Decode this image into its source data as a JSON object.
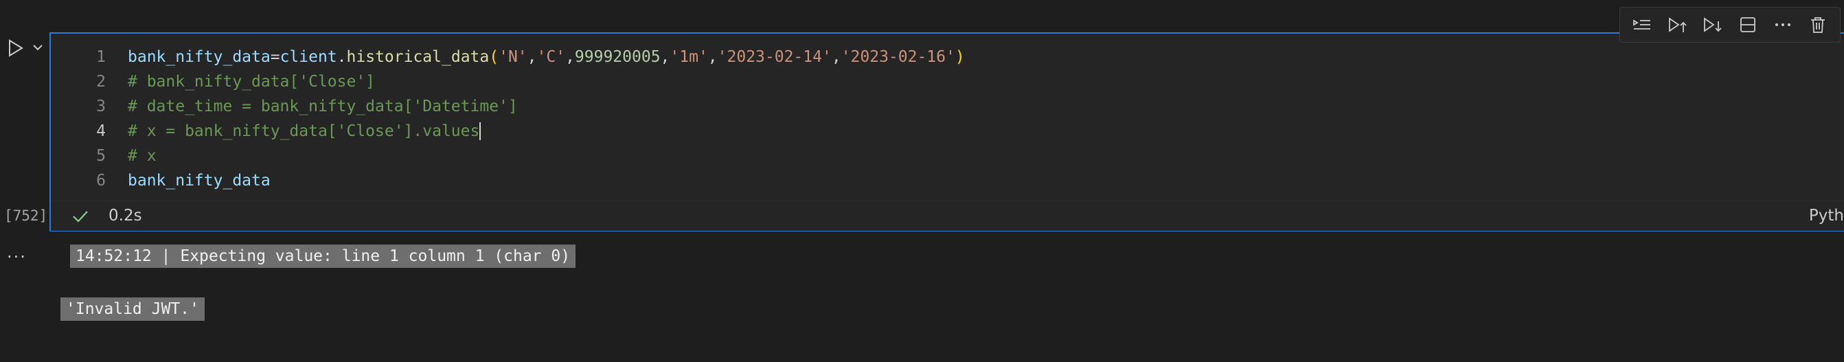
{
  "toolbar": {
    "items": [
      {
        "icon": "execute-above-icon",
        "label": "Execute cells above"
      },
      {
        "icon": "execute-cell-and-above-icon",
        "label": "Execute cell and above"
      },
      {
        "icon": "execute-cell-and-below-icon",
        "label": "Execute cell and below"
      },
      {
        "icon": "split-cell-icon",
        "label": "Split cell"
      },
      {
        "icon": "more-actions-icon",
        "label": "More actions"
      },
      {
        "icon": "delete-cell-icon",
        "label": "Delete cell"
      }
    ]
  },
  "cell": {
    "execution_count": "[752]",
    "active_line": 4,
    "lines": [
      {
        "number": "1",
        "text": "bank_nifty_data=client.historical_data('N','C',999920005,'1m','2023-02-14','2023-02-16')"
      },
      {
        "number": "2",
        "text": "# bank_nifty_data['Close']"
      },
      {
        "number": "3",
        "text": "# date_time = bank_nifty_data['Datetime']"
      },
      {
        "number": "4",
        "text": "# x = bank_nifty_data['Close'].values"
      },
      {
        "number": "5",
        "text": "# x"
      },
      {
        "number": "6",
        "text": "bank_nifty_data"
      }
    ],
    "tokens_line1": [
      {
        "t": "bank_nifty_data",
        "k": "var"
      },
      {
        "t": "=",
        "k": "punct"
      },
      {
        "t": "client",
        "k": "var"
      },
      {
        "t": ".",
        "k": "punct"
      },
      {
        "t": "historical_data",
        "k": "fn"
      },
      {
        "t": "(",
        "k": "paren"
      },
      {
        "t": "'N'",
        "k": "str"
      },
      {
        "t": ",",
        "k": "punct"
      },
      {
        "t": "'C'",
        "k": "str"
      },
      {
        "t": ",",
        "k": "punct"
      },
      {
        "t": "999920005",
        "k": "num"
      },
      {
        "t": ",",
        "k": "punct"
      },
      {
        "t": "'1m'",
        "k": "str"
      },
      {
        "t": ",",
        "k": "punct"
      },
      {
        "t": "'2023-02-14'",
        "k": "str"
      },
      {
        "t": ",",
        "k": "punct"
      },
      {
        "t": "'2023-02-16'",
        "k": "str"
      },
      {
        "t": ")",
        "k": "paren"
      }
    ],
    "status": {
      "duration": "0.2s",
      "language": "Pyth"
    }
  },
  "outputs": {
    "log_line": "14:52:12 | Expecting value: line 1 column 1 (char 0)",
    "result": "'Invalid JWT.'"
  },
  "colors": {
    "accent": "#2e7bd6",
    "success": "#89d185",
    "comment": "#6a9955",
    "string": "#ce9178"
  }
}
